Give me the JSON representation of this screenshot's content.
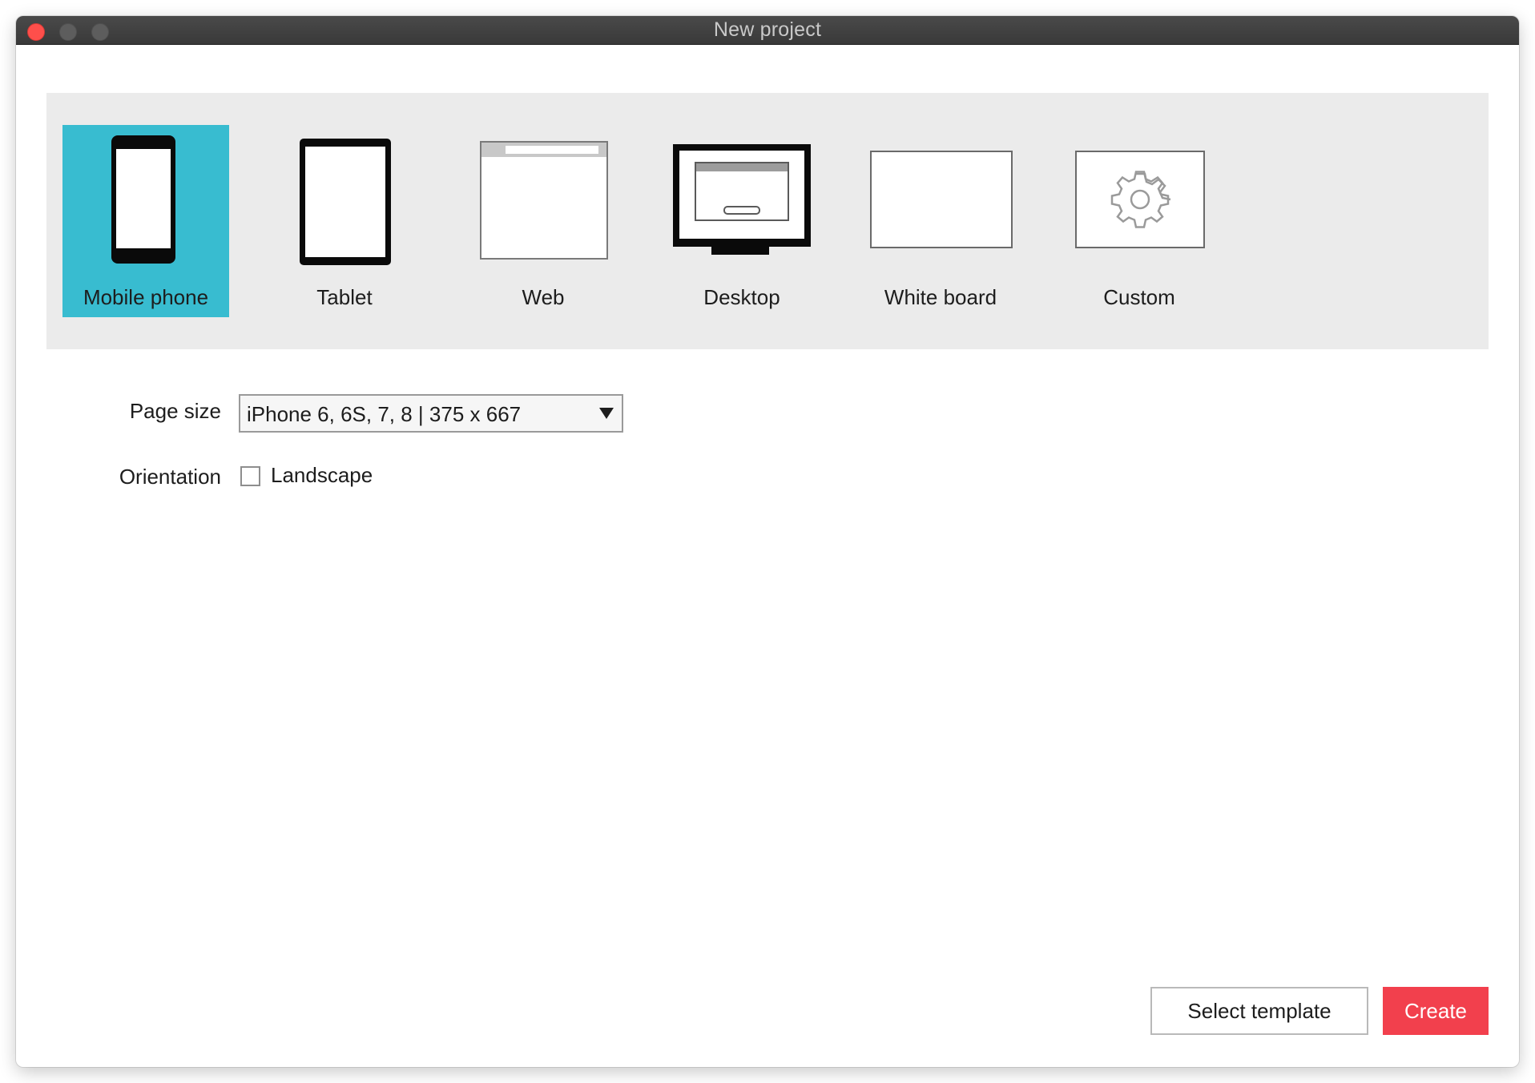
{
  "window": {
    "title": "New project"
  },
  "project_types": [
    {
      "label": "Mobile phone",
      "icon": "mobile-phone-icon",
      "selected": true
    },
    {
      "label": "Tablet",
      "icon": "tablet-icon",
      "selected": false
    },
    {
      "label": "Web",
      "icon": "web-browser-icon",
      "selected": false
    },
    {
      "label": "Desktop",
      "icon": "desktop-monitor-icon",
      "selected": false
    },
    {
      "label": "White board",
      "icon": "white-board-icon",
      "selected": false
    },
    {
      "label": "Custom",
      "icon": "gear-icon",
      "selected": false
    }
  ],
  "form": {
    "page_size_label": "Page size",
    "page_size_value": "iPhone 6, 6S, 7, 8 | 375 x 667",
    "orientation_label": "Orientation",
    "landscape_label": "Landscape",
    "landscape_checked": false
  },
  "buttons": {
    "select_template": "Select template",
    "create": "Create"
  },
  "colors": {
    "selected_accent": "#38bcd0",
    "create_button": "#f2404d",
    "close_button": "#fe4f4b"
  }
}
